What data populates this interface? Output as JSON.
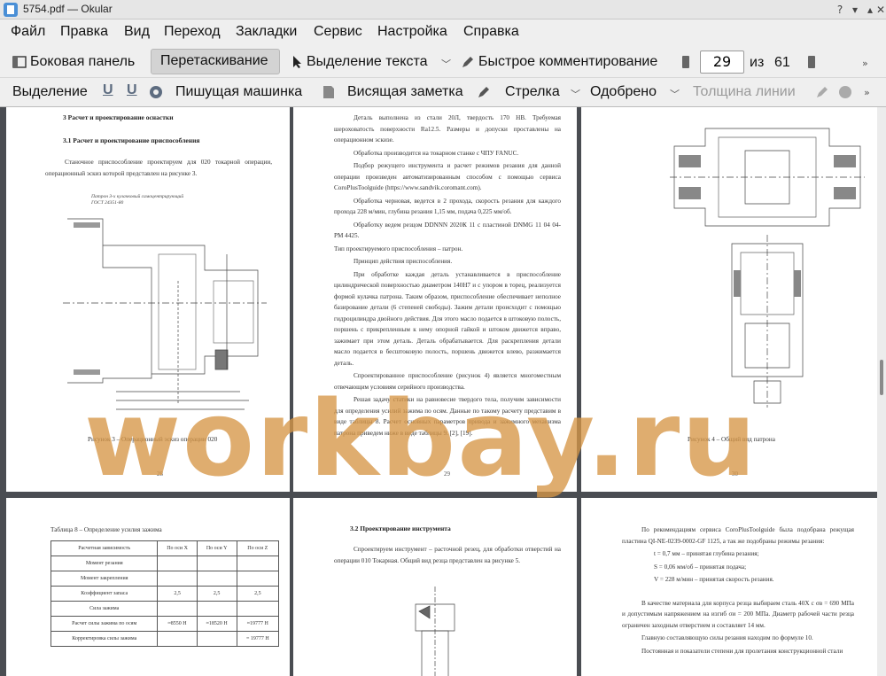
{
  "window": {
    "title": "5754.pdf  — Okular"
  },
  "menu": [
    "Файл",
    "Правка",
    "Вид",
    "Переход",
    "Закладки",
    "Сервис",
    "Настройка",
    "Справка"
  ],
  "toolbar1": {
    "sidebar": "Боковая панель",
    "drag": "Перетаскивание",
    "text_select": "Выделение текста",
    "quick_comment": "Быстрое комментирование",
    "page_current": "29",
    "page_of": "из",
    "page_total": "61"
  },
  "toolbar2": {
    "selection": "Выделение",
    "typewriter": "Пишущая машинка",
    "note": "Висящая заметка",
    "arrow": "Стрелка",
    "approved": "Одобрено",
    "line_width": "Толщина линии"
  },
  "watermark": "workbay.ru",
  "pages": {
    "p28": {
      "h1": "3 Расчет и проектирование оснастки",
      "h2": "3.1 Расчет и проектирование приспособления",
      "para": "Станочное приспособление проектируем для 020 токарной операции, операционный эскиз которой представлен на рисунке 3.",
      "drawing_label": "Патрон 3-х кулачковый самоцентрирующий ГОСТ 24351-80",
      "caption": "Рисунок 3 – Операционный эскиз операции 020",
      "number": "28"
    },
    "p29": {
      "paras": [
        "Деталь выполнена из стали 20Л, твердость 170 НВ. Требуемая шероховатость поверхности Ra12.5. Размеры и допуски проставлены на операционном эскизе.",
        "Обработка производится на токарном станке с ЧПУ FANUC.",
        "Подбор режущего инструмента и расчет режимов резания для данной операции произведен автоматизированным способом с помощью сервиса CoroPlusToolguide (https://www.sandvik.coromant.com).",
        "Обработка черновая, ведется в 2 прохода, скорость резания для каждого прохода 228 м/мин, глубина резания 1,15 мм, подача 0,225 мм/об.",
        "Обработку ведем резцом DDNNN 2020К 11 с пластиной DNMG 11 04 04-PM 4425.",
        "Тип проектируемого приспособления – патрон.",
        "Принцип действия приспособления.",
        "При обработке каждая деталь устанавливается в приспособление цилиндрической поверхностью диаметром 140Н7 и с упором в торец, реализуется формой кулачка патрона. Таким образом, приспособление обеспечивает неполное базирование детали (6 степеней свободы). Зажим детали происходит с помощью гидроцилиндра двойного действия. Для этого масло подается в штоковую полость, поршень с прикрепленным к нему опорной гайкой и штоком движется вправо, зажимает при этом деталь. Деталь обрабатывается. Для раскрепления детали масло подается в бесштоковую полость, поршень движется влево, разжимается деталь.",
        "Спроектированное приспособление (рисунок 4) является многоместным отвечающим условиям серийного производства.",
        "Решая задачу статики на равновесие твердого тела, получим зависимости для определения усилий зажима по осям. Данные по такому расчету представим в виде таблицы 8. Расчет основных параметров привода и зажимного механизма патрона приведем ниже в виде таблицы 9. [2], [19]."
      ],
      "number": "29"
    },
    "p30": {
      "caption": "Рисунок 4 – Общий вид патрона",
      "number": "30"
    },
    "p31": {
      "title": "Таблица 8 – Определение усилия зажима",
      "headers": [
        "Расчетная зависимость",
        "По оси X",
        "По оси Y",
        "По оси Z"
      ],
      "rows": [
        [
          "Момент резания",
          "",
          "",
          ""
        ],
        [
          "Момент закрепления",
          "",
          "",
          ""
        ],
        [
          "Коэффициент запаса",
          "2,5",
          "2,5",
          "2,5"
        ],
        [
          "Сила зажима",
          "",
          "",
          ""
        ],
        [
          "Расчет силы зажима по осям",
          "≈8550 Н",
          "≈18520 Н",
          "≈19777 Н"
        ],
        [
          "Корректировка силы зажима",
          "",
          "",
          "= 19777 Н"
        ]
      ]
    },
    "p32": {
      "h": "3.2 Проектирование инструмента",
      "para": "Спроектируем инструмент – расточной резец, для обработки отверстий на операции 010 Токарная. Общий вид резца представлен на рисунке 5."
    },
    "p33": {
      "para1": "По рекомендациям сервиса CoroPlusToolguide была подобрана режущая пластина QI-NE-0239-0002-GF 1125, а так же подобраны режимы резания:",
      "bullets": [
        "t = 0,7 мм – принятая глубина резания;",
        "S = 0,06 мм/об – принятая подача;",
        "V = 228 м/мин – принятая скорость резания."
      ],
      "para2": "В качестве материала для корпуса резца выбираем сталь 40Х с σв = 690 МПа и допустимым напряжением на изгиб σи = 200 МПа. Диаметр рабочей части резца ограничен заходным отверстием и составляет 14 мм.",
      "para3": "Главную составляющую силы резания находим по формуле 10.",
      "para4": "Постоянная и показатели степени для пролетания конструкционной стали"
    }
  }
}
